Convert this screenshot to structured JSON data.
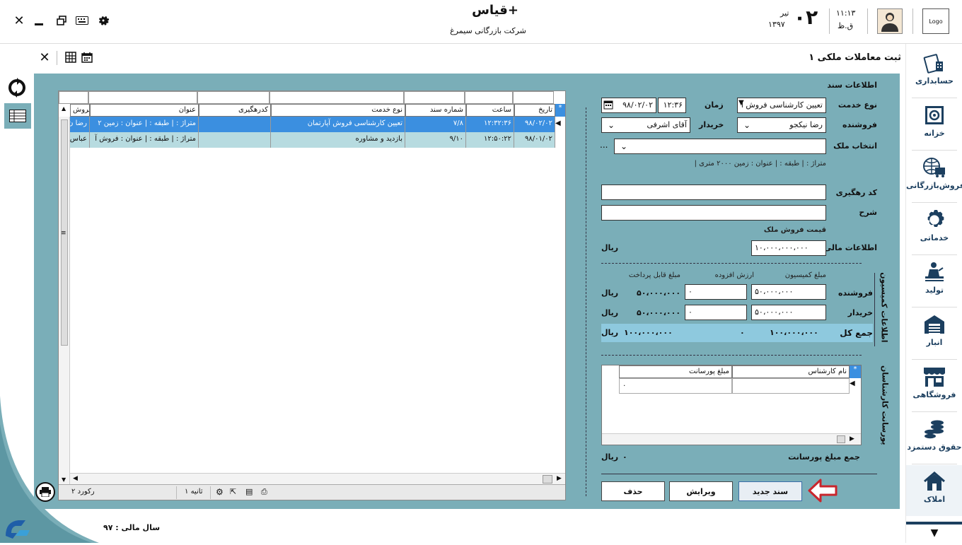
{
  "app": {
    "title": "قیاس+",
    "company": "شرکت بازرگانی سیمرغ",
    "logo_text": "Logo",
    "date_day": "۰۲",
    "date_month": "تیر",
    "date_year": "۱۳۹۷",
    "time": "۱۱:۱۳",
    "time_ampm": "ق.ظ"
  },
  "form": {
    "title": "ثبت معاملات ملکی ۱"
  },
  "sidebar": {
    "items": [
      {
        "label": "حسابداری",
        "icon": "accounting-icon"
      },
      {
        "label": "خزانه",
        "icon": "safe-icon"
      },
      {
        "label": "فروش‌بازرگانی",
        "icon": "trade-globe-icon"
      },
      {
        "label": "خدماتی",
        "icon": "gear-icon"
      },
      {
        "label": "تولید",
        "icon": "worker-icon"
      },
      {
        "label": "انبار",
        "icon": "warehouse-icon"
      },
      {
        "label": "فروشگاهی",
        "icon": "store-icon"
      },
      {
        "label": "حقوق دستمزد",
        "icon": "coins-icon"
      },
      {
        "label": "املاک",
        "icon": "house-icon"
      }
    ]
  },
  "doc": {
    "section_label": "اطلاعات سند",
    "service_type_label": "نوع خدمت",
    "service_type_value": "تعیین کارشناسی فروش آ",
    "time_label": "زمان",
    "time_value": "۱۲:۳۶",
    "date_value": "۹۸/۰۲/۰۲",
    "seller_label": "فروشنده",
    "seller_value": "رضا نیکجو",
    "buyer_label": "خریدار",
    "buyer_value": "آقای اشرفی",
    "property_label": "انتخاب ملک",
    "property_ellipsis": "...",
    "property_desc": "متراژ : | طبقه : | عنوان : زمین ۲۰۰۰ متری |",
    "tracking_label": "کد رهگیری",
    "desc_label": "شرح",
    "sale_price_label": "قیمت فروش ملک",
    "financial_label": "اطلاعات مالی",
    "sale_price_value": "۱۰،۰۰۰،۰۰۰،۰۰۰",
    "currency": "ریال"
  },
  "commission": {
    "section_label": "اطلاعات کمیسیون",
    "col_commission": "مبلغ کمیسیون",
    "col_vat": "ارزش افزوده",
    "col_payable": "مبلغ قابل پرداخت",
    "seller_label": "فروشنده",
    "seller_commission": "۵۰،۰۰۰،۰۰۰",
    "seller_vat": "۰",
    "seller_payable": "۵۰،۰۰۰،۰۰۰",
    "buyer_label": "خریدار",
    "buyer_commission": "۵۰،۰۰۰،۰۰۰",
    "buyer_vat": "۰",
    "buyer_payable": "۵۰،۰۰۰،۰۰۰",
    "total_label": "جمع کل",
    "total_commission": "۱۰۰،۰۰۰،۰۰۰",
    "total_vat": "۰",
    "total_payable": "۱۰۰،۰۰۰،۰۰۰",
    "currency": "ریال"
  },
  "agent": {
    "section_label": "پورسانت کارشناسان",
    "col_name": "نام کارشناس",
    "col_amount": "مبلغ پورسانت",
    "row_amount": "۰",
    "total_label": "جمع مبلغ پورسانت",
    "total_value": "۰",
    "currency": "ریال"
  },
  "buttons": {
    "new_doc": "سند جدید",
    "edit": "ویرایش",
    "delete": "حذف"
  },
  "grid": {
    "headers": [
      "تاریخ",
      "ساعت",
      "شماره سند",
      "نوع خدمت",
      "کدرهگیری",
      "عنوان",
      "فروش"
    ],
    "rows": [
      [
        "۹۸/۰۲/۰۲",
        "۱۲:۳۲:۳۶",
        "۷/۸",
        "تعیین کارشناسی فروش آپارتمان",
        "",
        "متراژ : | طبقه : | عنوان : زمین ۲",
        "رضا ن"
      ],
      [
        "۹۸/۰۱/۰۲",
        "۱۲:۵۰:۲۲",
        "۹/۱۰",
        "بازدید و مشاوره",
        "",
        "متراژ : | طبقه : | عنوان : فروش آ",
        "عباس"
      ]
    ],
    "record_count": "۲ رکورد",
    "refresh_interval": "۱ ثانیه"
  },
  "footer": {
    "fiscal_year": "سال مالی : ۹۷"
  },
  "colors": {
    "panel": "#7aaeb8",
    "selected_row": "#3b8fe0",
    "total_row": "#8ec9de",
    "accent_red": "#c9252c"
  }
}
